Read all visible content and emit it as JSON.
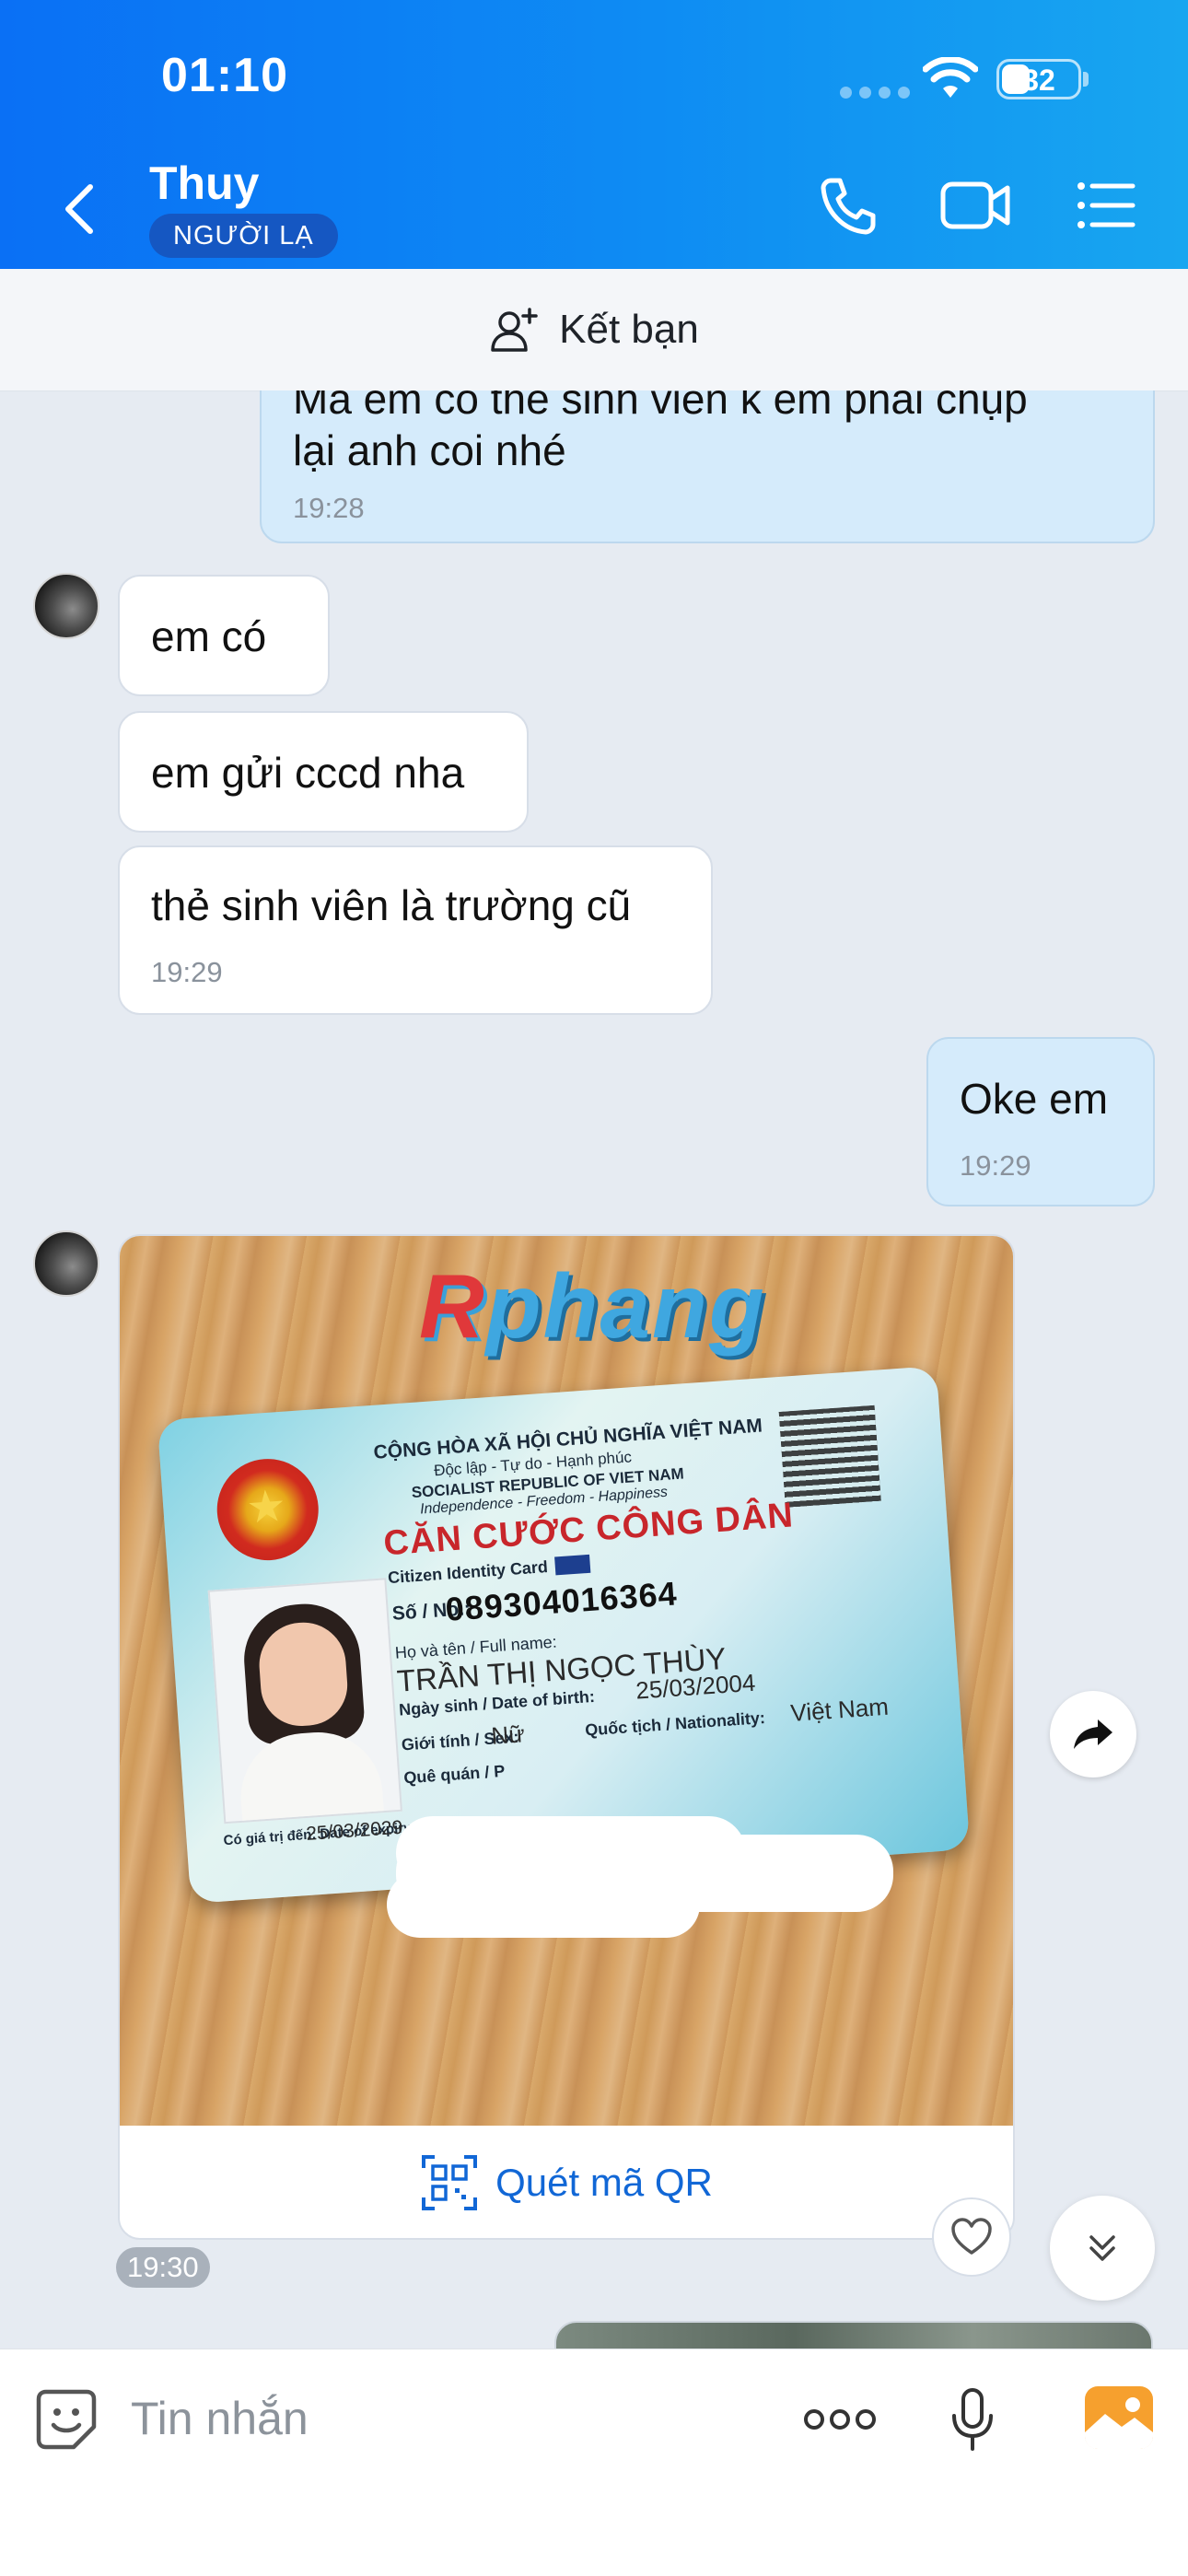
{
  "status_bar": {
    "time": "01:10",
    "battery": "32"
  },
  "header": {
    "contact_name": "Thuy",
    "stranger_badge": "NGƯỜI LẠ"
  },
  "friend_bar": {
    "label": "Kết bạn"
  },
  "messages": [
    {
      "direction": "out",
      "text": "Mà em có thẻ sinh viên k em phải chụp",
      "text2": "lại anh coi nhé",
      "time": "19:28"
    },
    {
      "direction": "in",
      "text": "em có"
    },
    {
      "direction": "in",
      "text": "em gửi cccd nha"
    },
    {
      "direction": "in",
      "text": "thẻ sinh viên là trường cũ",
      "time": "19:29"
    },
    {
      "direction": "out",
      "text": "Oke em",
      "time": "19:29"
    }
  ],
  "photo_message": {
    "watermark_a": "R",
    "watermark_b": "phang",
    "qr_action": "Quét mã QR",
    "time": "19:30",
    "card": {
      "header1": "CỘNG HÒA XÃ HỘI CHỦ NGHĨA VIỆT NAM",
      "header2": "Độc lập - Tự do - Hạnh phúc",
      "header3": "SOCIALIST REPUBLIC OF VIET NAM",
      "header4": "Independence - Freedom - Happiness",
      "title": "CĂN CƯỚC CÔNG DÂN",
      "subtitle": "Citizen Identity Card",
      "number_label": "Số / No.:",
      "number": "089304016364",
      "name_label": "Họ và tên / Full name:",
      "name": "TRẦN THỊ NGỌC THÙY",
      "dob_label": "Ngày sinh / Date of birth:",
      "dob": "25/03/2004",
      "sex_label": "Giới tính / Sex:",
      "sex": "Nữ",
      "nationality_label": "Quốc tịch / Nationality:",
      "nationality": "Việt Nam",
      "hometown_label": "Quê quán / P",
      "expiry_label": "Có giá trị đến: Date of expiry",
      "expiry": "25/03/2029"
    }
  },
  "input_bar": {
    "placeholder": "Tin nhắn"
  },
  "colors": {
    "header_start": "#0a70f5",
    "header_end": "#18a6f0",
    "outgoing_bubble": "#d5ebfb",
    "link_blue": "#1167d6",
    "chat_background": "#e6ebf2"
  }
}
